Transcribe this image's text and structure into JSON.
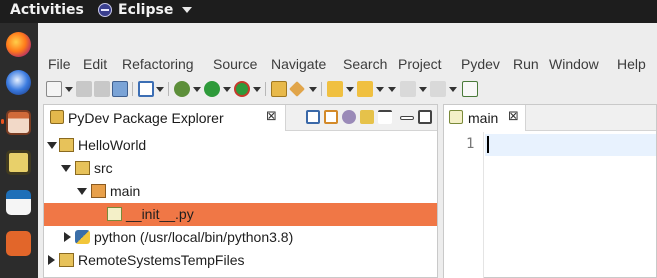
{
  "system_bar": {
    "activities": "Activities",
    "app_name": "Eclipse"
  },
  "dock": {
    "items": [
      "firefox-icon",
      "thunderbird-icon",
      "files-icon",
      "rhythmbox-icon",
      "writer-icon",
      "software-icon"
    ]
  },
  "menu": {
    "items": [
      {
        "label": "File"
      },
      {
        "label": "Edit"
      },
      {
        "label": "Refactoring"
      },
      {
        "label": "Source"
      },
      {
        "label": "Navigate"
      },
      {
        "label": "Search"
      },
      {
        "label": "Project"
      },
      {
        "label": "Pydev"
      },
      {
        "label": "Run"
      },
      {
        "label": "Window"
      },
      {
        "label": "Help"
      }
    ]
  },
  "explorer": {
    "title": "PyDev Package Explorer",
    "close": "⊠",
    "tree": [
      {
        "label": "HelloWorld"
      },
      {
        "label": "src"
      },
      {
        "label": "main"
      },
      {
        "label": "__init__.py",
        "selected": true
      },
      {
        "label": "python  (/usr/local/bin/python3.8)"
      },
      {
        "label": "RemoteSystemsTempFiles"
      }
    ]
  },
  "editor": {
    "tab_label": "main",
    "close": "⊠",
    "line_number": "1"
  },
  "colors": {
    "selection": "#f07746",
    "accent": "#e95420"
  }
}
